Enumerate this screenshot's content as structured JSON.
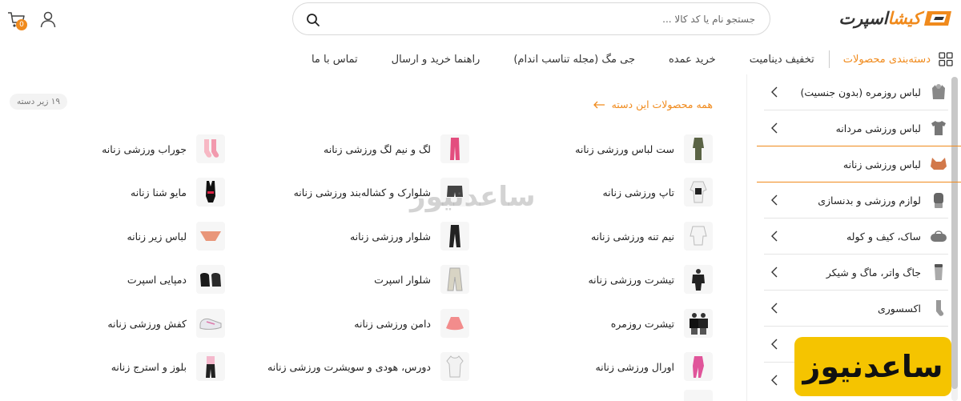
{
  "header": {
    "logo_text": "کیشااسپرت",
    "search_placeholder": "جستجو نام یا کد کالا ...",
    "cart_count": "0"
  },
  "nav": {
    "categories_label": "دسته‌بندی محصولات",
    "links": [
      "تخفیف دینامیت",
      "خرید عمده",
      "جی مگ (مجله تناسب اندام)",
      "راهنما خرید و ارسال",
      "تماس با ما"
    ]
  },
  "sidebar": {
    "items": [
      {
        "label": "لباس روزمره (بدون جنسیت)",
        "icon": "hoodie-icon"
      },
      {
        "label": "لباس ورزشی مردانه",
        "icon": "tshirt-icon"
      },
      {
        "label": "لباس ورزشی زنانه",
        "icon": "sports-bra-icon"
      },
      {
        "label": "لوازم ورزشی و بدنسازی",
        "icon": "glove-icon"
      },
      {
        "label": "ساک، کیف و کوله",
        "icon": "bag-icon"
      },
      {
        "label": "جاگ واتر، ماگ و شیکر",
        "icon": "shaker-icon"
      },
      {
        "label": "اکسسوری",
        "icon": "sock-icon"
      }
    ]
  },
  "main": {
    "all_products_label": "همه محصولات این دسته",
    "subcategory_count": "۱۹ زیر دسته",
    "columns": [
      [
        "ست لباس ورزشی زنانه",
        "تاپ ورزشی زنانه",
        "نیم تنه ورزشی زنانه",
        "تیشرت ورزشی زنانه",
        "تیشرت روزمره",
        "اورال ورزشی زنانه"
      ],
      [
        "لگ و نیم لگ ورزشی زنانه",
        "شلوارک و کشاله‌بند ورزشی زنانه",
        "شلوار ورزشی زنانه",
        "شلوار اسپرت",
        "دامن ورزشی زنانه",
        "دورس، هودی و سویشرت ورزشی زنانه"
      ],
      [
        "جوراب ورزشی زنانه",
        "مایو شنا زنانه",
        "لباس زیر زنانه",
        "دمپایی اسپرت",
        "کفش ورزشی زنانه",
        "بلوز و استرج زنانه"
      ]
    ]
  },
  "watermark": {
    "text": "ساعدنیوز"
  },
  "colors": {
    "accent": "#f08a1c",
    "watermark_bg": "#f5c400"
  }
}
